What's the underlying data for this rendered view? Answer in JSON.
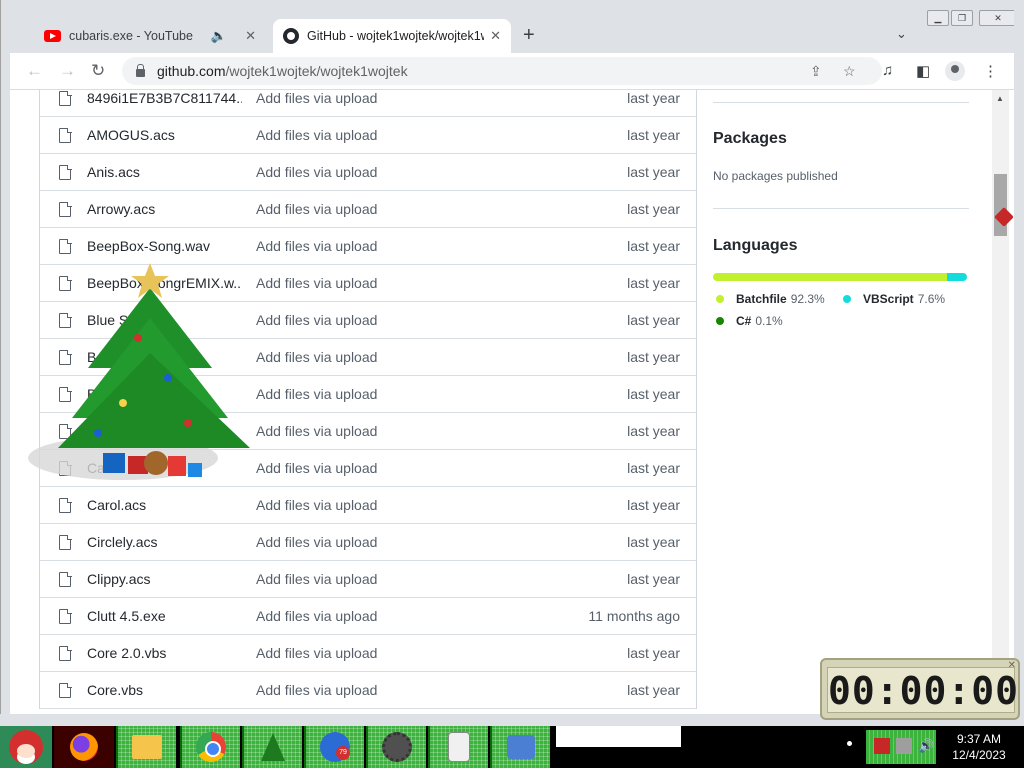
{
  "browser": {
    "tabs": [
      {
        "title": "cubaris.exe - YouTube",
        "icon": "youtube-icon",
        "audio": true
      },
      {
        "title": "GitHub - wojtek1wojtek/wojtek1wojtek",
        "icon": "github-icon",
        "active": true
      }
    ],
    "url_host": "github.com",
    "url_path": "/wojtek1wojtek/wojtek1wojtek"
  },
  "files": [
    {
      "name": "8496i1E7B3B7C811744...",
      "message": "Add files via upload",
      "age": "last year"
    },
    {
      "name": "AMOGUS.acs",
      "message": "Add files via upload",
      "age": "last year"
    },
    {
      "name": "Anis.acs",
      "message": "Add files via upload",
      "age": "last year"
    },
    {
      "name": "Arrowy.acs",
      "message": "Add files via upload",
      "age": "last year"
    },
    {
      "name": "BeepBox-Song.wav",
      "message": "Add files via upload",
      "age": "last year"
    },
    {
      "name": "BeepBox-SongrEMIX.w...",
      "message": "Add files via upload",
      "age": "last year"
    },
    {
      "name": "Blue S...",
      "message": "Add files via upload",
      "age": "last year"
    },
    {
      "name": "Bo...",
      "message": "Add files via upload",
      "age": "last year"
    },
    {
      "name": "B...",
      "message": "Add files via upload",
      "age": "last year"
    },
    {
      "name": "",
      "message": "Add files via upload",
      "age": "last year"
    },
    {
      "name": "Ca...",
      "message": "Add files via upload",
      "age": "last year"
    },
    {
      "name": "Carol.acs",
      "message": "Add files via upload",
      "age": "last year"
    },
    {
      "name": "Circlely.acs",
      "message": "Add files via upload",
      "age": "last year"
    },
    {
      "name": "Clippy.acs",
      "message": "Add files via upload",
      "age": "last year"
    },
    {
      "name": "Clutt 4.5.exe",
      "message": "Add files via upload",
      "age": "11 months ago"
    },
    {
      "name": "Core 2.0.vbs",
      "message": "Add files via upload",
      "age": "last year"
    },
    {
      "name": "Core.vbs",
      "message": "Add files via upload",
      "age": "last year"
    }
  ],
  "sidebar": {
    "packages_heading": "Packages",
    "packages_text": "No packages published",
    "languages_heading": "Languages",
    "languages": [
      {
        "name": "Batchfile",
        "percent": "92.3%",
        "value": 92.3,
        "color": "#C1F12E"
      },
      {
        "name": "VBScript",
        "percent": "7.6%",
        "value": 7.6,
        "color": "#15dcdc"
      },
      {
        "name": "C#",
        "percent": "0.1%",
        "value": 0.1,
        "color": "#178600"
      }
    ]
  },
  "timer": {
    "display": "00:00:00"
  },
  "taskbar": {
    "items": [
      "firefox-icon",
      "folder-icon",
      "chrome-icon",
      "christmas-tree-icon",
      "globe-icon",
      "minesweeper-icon",
      "solitaire-icon",
      "control-panel-icon"
    ],
    "badge": "79",
    "time": "9:37 AM",
    "date": "12/4/2023"
  }
}
